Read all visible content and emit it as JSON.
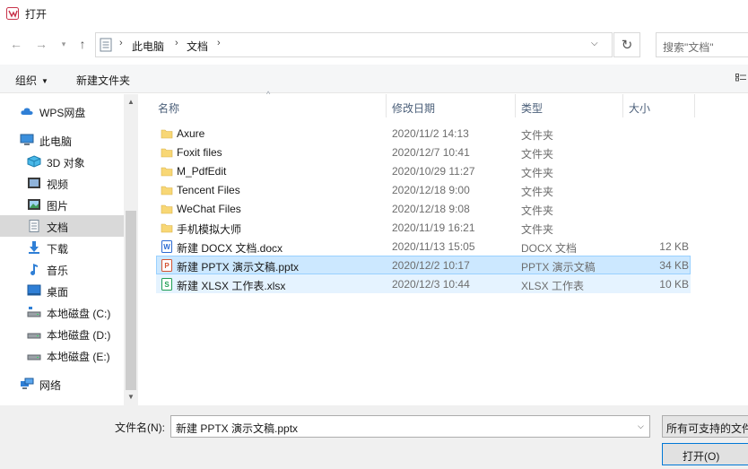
{
  "window": {
    "title": "打开"
  },
  "address": {
    "crumbs": [
      "此电脑",
      "文档"
    ],
    "search_placeholder": "搜索\"文档\""
  },
  "toolbar": {
    "organize": "组织",
    "new_folder": "新建文件夹"
  },
  "nav": {
    "items": [
      {
        "label": "WPS网盘",
        "icon": "cloud-icon"
      },
      {
        "label": "此电脑",
        "icon": "computer-icon"
      },
      {
        "label": "3D 对象",
        "icon": "cube-3d-icon"
      },
      {
        "label": "视频",
        "icon": "video-icon"
      },
      {
        "label": "图片",
        "icon": "picture-icon"
      },
      {
        "label": "文档",
        "icon": "document-icon",
        "selected": true
      },
      {
        "label": "下载",
        "icon": "download-icon"
      },
      {
        "label": "音乐",
        "icon": "music-icon"
      },
      {
        "label": "桌面",
        "icon": "desktop-icon"
      },
      {
        "label": "本地磁盘 (C:)",
        "icon": "drive-c-icon"
      },
      {
        "label": "本地磁盘 (D:)",
        "icon": "drive-icon"
      },
      {
        "label": "本地磁盘 (E:)",
        "icon": "drive-icon"
      },
      {
        "label": "网络",
        "icon": "network-icon"
      }
    ]
  },
  "columns": {
    "name": "名称",
    "modified": "修改日期",
    "type": "类型",
    "size": "大小"
  },
  "files": [
    {
      "name": "Axure",
      "modified": "2020/11/2 14:13",
      "type": "文件夹",
      "size": "",
      "icon": "folder-icon"
    },
    {
      "name": "Foxit files",
      "modified": "2020/12/7 10:41",
      "type": "文件夹",
      "size": "",
      "icon": "folder-icon"
    },
    {
      "name": "M_PdfEdit",
      "modified": "2020/10/29 11:27",
      "type": "文件夹",
      "size": "",
      "icon": "folder-icon"
    },
    {
      "name": "Tencent Files",
      "modified": "2020/12/18 9:00",
      "type": "文件夹",
      "size": "",
      "icon": "folder-icon"
    },
    {
      "name": "WeChat Files",
      "modified": "2020/12/18 9:08",
      "type": "文件夹",
      "size": "",
      "icon": "folder-icon"
    },
    {
      "name": "手机模拟大师",
      "modified": "2020/11/19 16:21",
      "type": "文件夹",
      "size": "",
      "icon": "folder-icon"
    },
    {
      "name": "新建 DOCX 文档.docx",
      "modified": "2020/11/13 15:05",
      "type": "DOCX 文档",
      "size": "12 KB",
      "icon": "docx-icon"
    },
    {
      "name": "新建 PPTX 演示文稿.pptx",
      "modified": "2020/12/2 10:17",
      "type": "PPTX 演示文稿",
      "size": "34 KB",
      "icon": "pptx-icon",
      "selected": true
    },
    {
      "name": "新建 XLSX 工作表.xlsx",
      "modified": "2020/12/3 10:44",
      "type": "XLSX 工作表",
      "size": "10 KB",
      "icon": "xlsx-icon",
      "hover": true
    }
  ],
  "bottom": {
    "filename_label": "文件名(N):",
    "filename_value": "新建 PPTX 演示文稿.pptx",
    "filetype": "所有可支持的文件",
    "open_button": "打开(O)"
  },
  "colors": {
    "folder": "#f8d775",
    "docx": "#2b6ad3",
    "pptx": "#d35230",
    "xlsx": "#1e9e52",
    "selection": "#cce8ff"
  }
}
